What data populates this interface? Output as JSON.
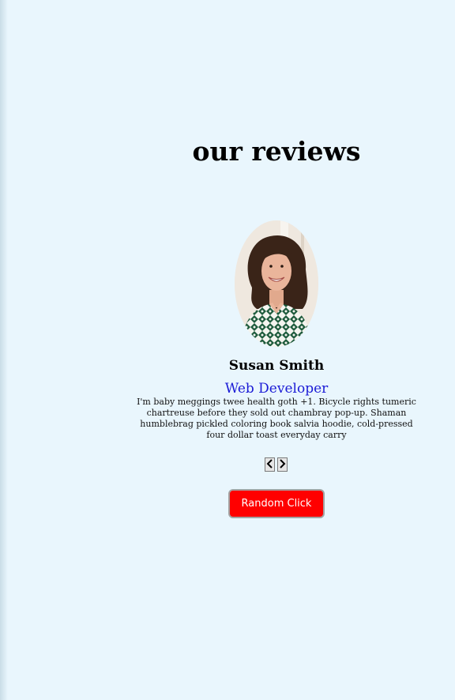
{
  "section": {
    "title": "our reviews"
  },
  "review": {
    "name": "Susan Smith",
    "job": "Web Developer",
    "text": "I'm baby meggings twee health goth +1. Bicycle rights tumeric chartreuse before they sold out chambray pop-up. Shaman humblebrag pickled coloring book salvia hoodie, cold-pressed four dollar toast everyday carry"
  },
  "controls": {
    "prev_icon": "chevron-left-icon",
    "next_icon": "chevron-right-icon",
    "random_label": "Random Click"
  },
  "colors": {
    "background": "#e9f6fd",
    "job": "#1b1bd6",
    "random_button": "#ff0000"
  }
}
